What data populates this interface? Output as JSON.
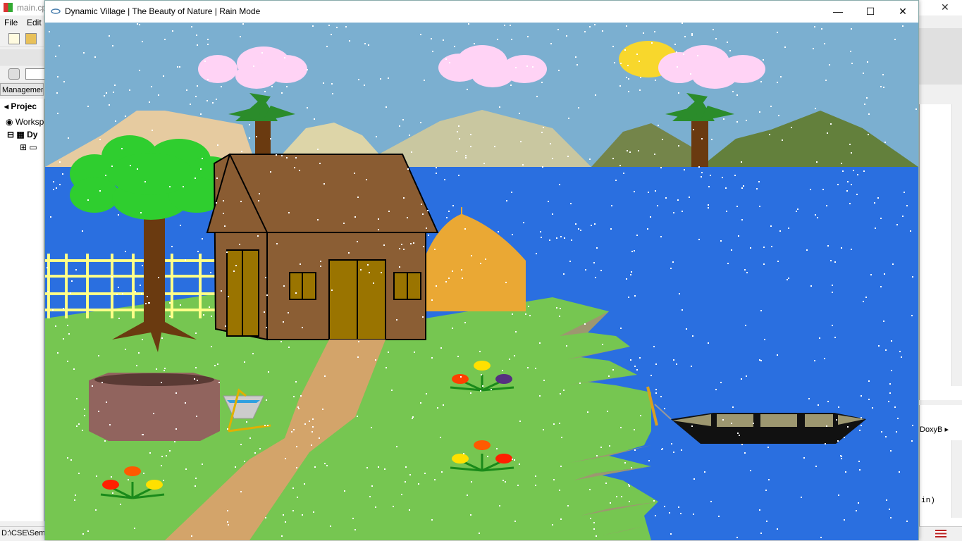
{
  "ide": {
    "title": "main.cp",
    "menu": [
      "File",
      "Edit"
    ],
    "management_label": "Managemen",
    "tree": {
      "tab": "Projec",
      "workspace": "Worksp",
      "project": "Dy"
    },
    "right_label": "DoxyB",
    "right_text": "in)",
    "status_path": "D:\\CSE\\Sem"
  },
  "window": {
    "title": "Dynamic Village | The Beauty of Nature | Rain Mode",
    "minimize": "—",
    "maximize": "☐",
    "close": "✕"
  },
  "scene": {
    "colors": {
      "sky": "#7bafd0",
      "lake": "#2a6fe0",
      "grass": "#76c651",
      "path": "#d3a46a",
      "house_wall": "#8b5e34",
      "house_roof": "#8a5c32",
      "door": "#9a7400",
      "haystack": "#eaa834",
      "fence": "#ffff88",
      "tree_leaves": "#2fce2f",
      "trunk": "#6a3a10",
      "cloud": "#ffd3f5",
      "sun": "#f8d72c",
      "well": "#91645e",
      "boat": "#111111"
    },
    "mode": "Rain Mode"
  }
}
